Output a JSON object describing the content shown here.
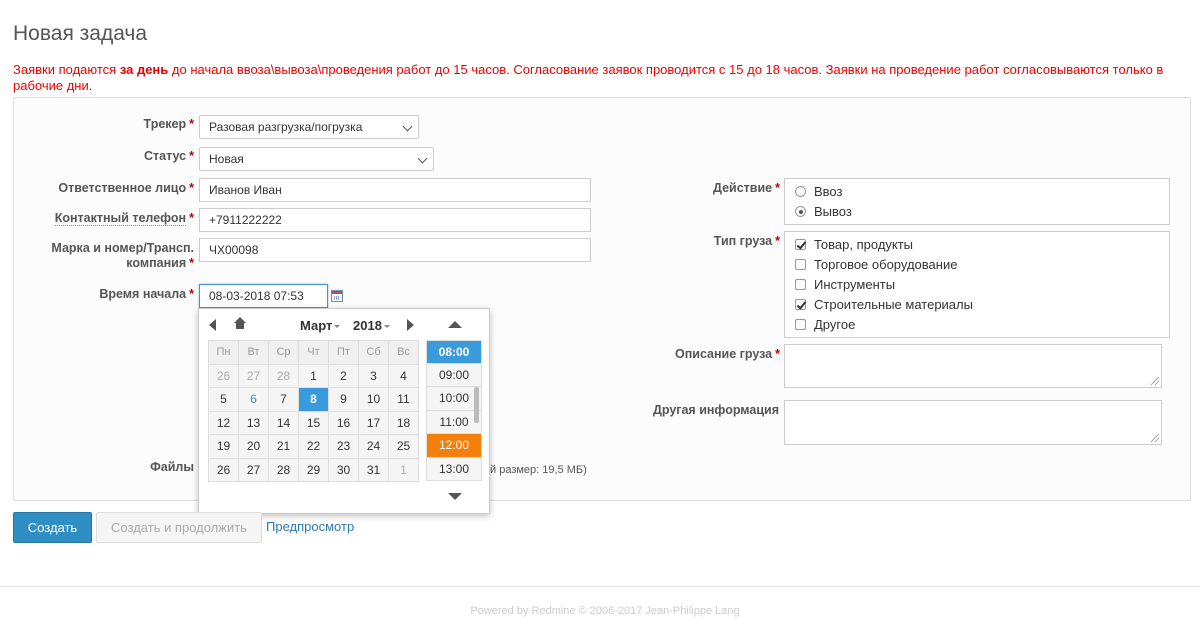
{
  "page": {
    "title": "Новая задача",
    "notice_before": "Заявки подаются ",
    "notice_bold": "за день",
    "notice_after": " до начала ввоза\\вывоза\\проведения работ до 15 часов. Согласование заявок проводится с 15 до 18 часов. Заявки на проведение работ согласовываются только в рабочие дни."
  },
  "form": {
    "required_mark": "*",
    "tracker": {
      "label": "Трекер",
      "value": "Разовая разгрузка/погрузка"
    },
    "status": {
      "label": "Статус",
      "value": "Новая"
    },
    "responsible": {
      "label": "Ответственное лицо",
      "value": "Иванов Иван"
    },
    "phone": {
      "label": "Контактный телефон",
      "value": "+7911222222"
    },
    "vehicle": {
      "label_line1": "Марка и номер/Трансп.",
      "label_line2": "компания",
      "value": "ЧХ00098"
    },
    "start_time": {
      "label": "Время начала",
      "value": "08-03-2018 07:53"
    },
    "files": {
      "label": "Файлы",
      "note": "й размер: 19,5 МБ)"
    },
    "action": {
      "label": "Действие",
      "options": [
        "Ввоз",
        "Вывоз"
      ],
      "selected": "Вывоз"
    },
    "cargo_type": {
      "label": "Тип груза",
      "options": [
        {
          "label": "Товар, продукты",
          "checked": true
        },
        {
          "label": "Торговое оборудование",
          "checked": false
        },
        {
          "label": "Инструменты",
          "checked": false
        },
        {
          "label": "Строительные материалы",
          "checked": true
        },
        {
          "label": "Другое",
          "checked": false
        }
      ]
    },
    "cargo_desc": {
      "label": "Описание груза"
    },
    "other_info": {
      "label": "Другая информация"
    }
  },
  "datepicker": {
    "month": "Март",
    "year": "2018",
    "weekdays": [
      "Пн",
      "Вт",
      "Ср",
      "Чт",
      "Пт",
      "Сб",
      "Вс"
    ],
    "weeks": [
      [
        "26",
        "27",
        "28",
        "1",
        "2",
        "3",
        "4"
      ],
      [
        "5",
        "6",
        "7",
        "8",
        "9",
        "10",
        "11"
      ],
      [
        "12",
        "13",
        "14",
        "15",
        "16",
        "17",
        "18"
      ],
      [
        "19",
        "20",
        "21",
        "22",
        "23",
        "24",
        "25"
      ],
      [
        "26",
        "27",
        "28",
        "29",
        "30",
        "31",
        "1"
      ]
    ],
    "selected_day": "8",
    "today_day": "6",
    "times": [
      "08:00",
      "09:00",
      "10:00",
      "11:00",
      "12:00",
      "13:00"
    ],
    "selected_time": "08:00",
    "highlighted_time": "12:00"
  },
  "buttons": {
    "create": "Создать",
    "create_continue": "Создать и продолжить",
    "preview": "Предпросмотр"
  },
  "footer": "Powered by Redmine © 2006-2017 Jean-Philippe Lang"
}
